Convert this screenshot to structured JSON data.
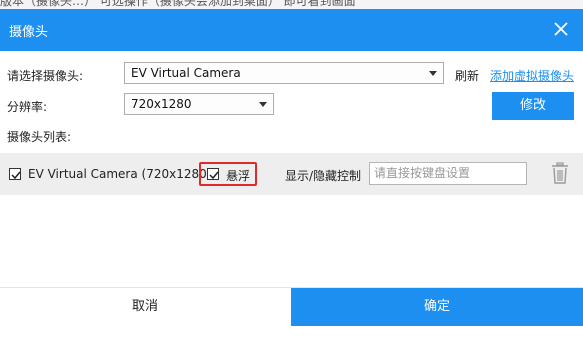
{
  "background_text": "版本（摄像头…）  可选操作（摄像头会添加到桌面）  即可看到画面",
  "dialog": {
    "title": "摄像头",
    "close_icon": "close-icon"
  },
  "form": {
    "select_camera_label": "请选择摄像头:",
    "camera_value": "EV Virtual Camera",
    "refresh_label": "刷新",
    "add_virtual_camera_link": "添加虚拟摄像头",
    "resolution_label": "分辨率:",
    "resolution_value": "720x1280",
    "modify_button": "修改",
    "camera_list_label": "摄像头列表:"
  },
  "camera_list": [
    {
      "checked": true,
      "name": "EV Virtual Camera (720x1280)",
      "float_checked": true,
      "float_label": "悬浮",
      "toggle_label": "显示/隐藏控制",
      "hotkey_placeholder": "请直接按键盘设置",
      "hotkey_value": ""
    }
  ],
  "footer": {
    "cancel_button": "取消",
    "confirm_button": "确定"
  },
  "colors": {
    "accent": "#1d8ff0",
    "highlight_border": "#e02a2a",
    "row_background": "#eeeeee"
  }
}
